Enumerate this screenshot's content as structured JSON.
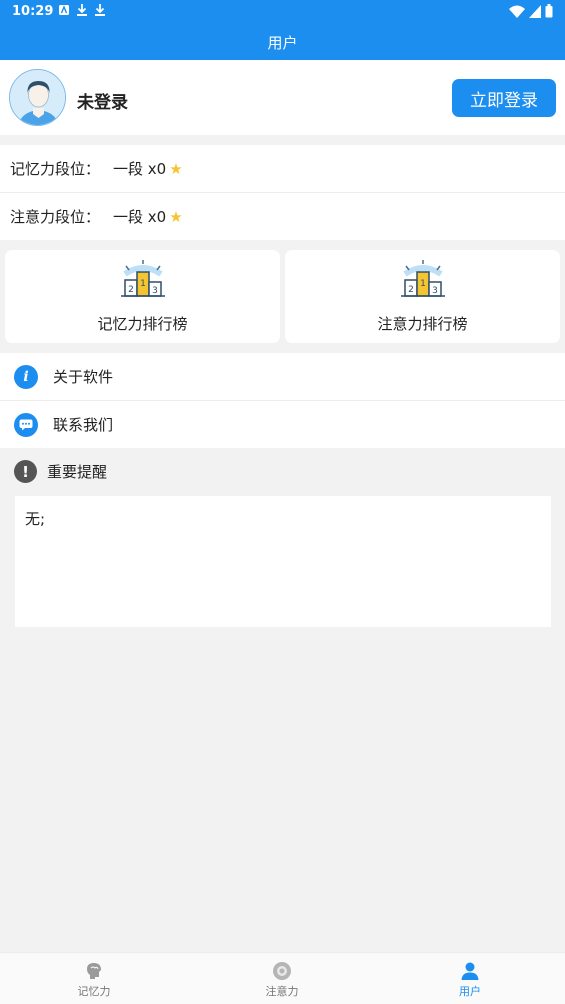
{
  "status_bar": {
    "time": "10:29"
  },
  "app_bar": {
    "title": "用户"
  },
  "profile": {
    "name": "未登录",
    "login_button": "立即登录"
  },
  "ranks": [
    {
      "label": "记忆力段位：",
      "value": "一段 x0"
    },
    {
      "label": "注意力段位：",
      "value": "一段 x0"
    }
  ],
  "boards": [
    {
      "label": "记忆力排行榜"
    },
    {
      "label": "注意力排行榜"
    }
  ],
  "menu": [
    {
      "label": "关于软件",
      "icon": "info-icon"
    },
    {
      "label": "联系我们",
      "icon": "chat-icon"
    }
  ],
  "notice": {
    "title": "重要提醒",
    "content": "无;"
  },
  "tabs": [
    {
      "label": "记忆力",
      "icon": "brain-icon",
      "active": false
    },
    {
      "label": "注意力",
      "icon": "focus-icon",
      "active": false
    },
    {
      "label": "用户",
      "icon": "user-icon",
      "active": true
    }
  ],
  "colors": {
    "accent": "#1b8ef0",
    "background": "#f2f2f2",
    "star": "#f5c531"
  }
}
